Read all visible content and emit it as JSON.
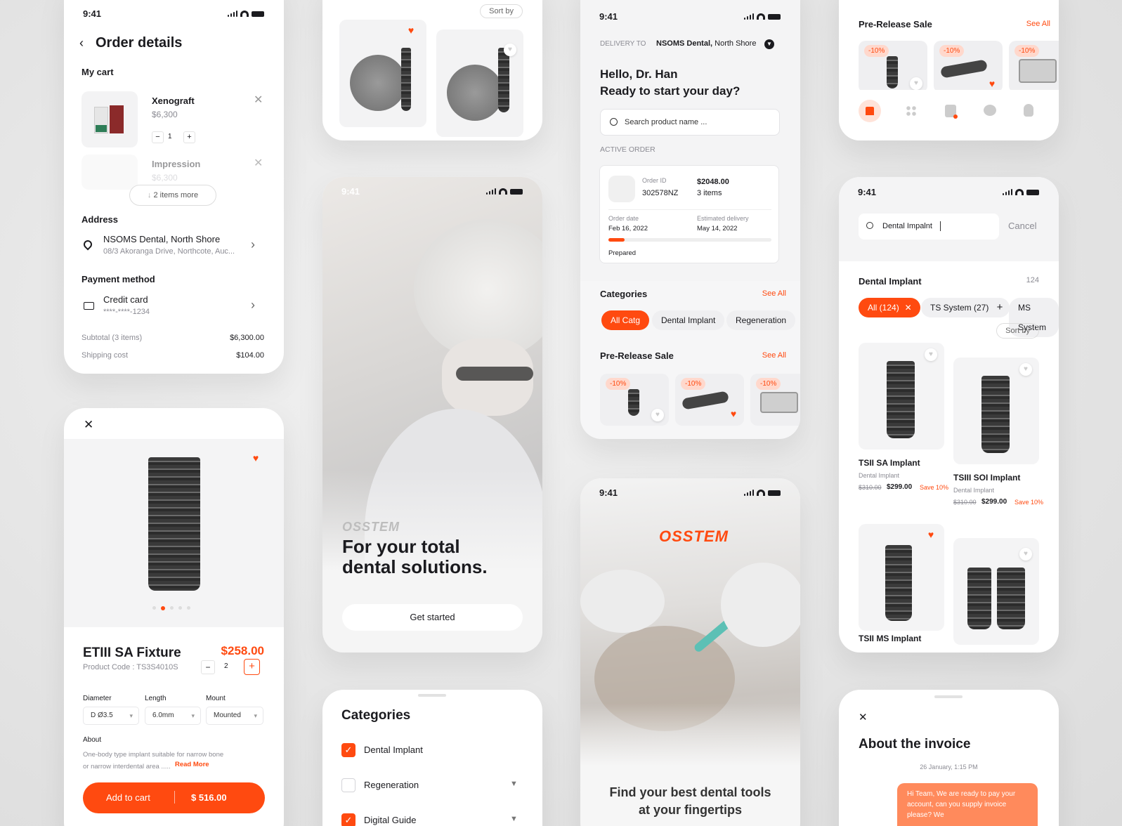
{
  "status_time": "9:41",
  "order": {
    "title": "Order details",
    "my_cart": "My cart",
    "items": [
      {
        "name": "Xenograft",
        "price": "$6,300",
        "qty": "1"
      },
      {
        "name": "Impression",
        "price": "$6,300"
      }
    ],
    "more": "2 items more",
    "address_label": "Address",
    "address_name": "NSOMS Dental, North Shore",
    "address_line": "08/3 Akoranga Drive, Northcote, Auc...",
    "payment_label": "Payment method",
    "payment_name": "Credit card",
    "payment_num": "****-****-1234",
    "subtotal_label": "Subtotal (3 items)",
    "subtotal_value": "$6,300.00",
    "shipping_label": "Shipping cost",
    "shipping_value": "$104.00"
  },
  "product": {
    "name": "ETIII SA Fixture",
    "code": "Product Code : TS3S4010S",
    "price": "$258.00",
    "qty": "2",
    "diameter_label": "Diameter",
    "diameter": "D Ø3.5",
    "length_label": "Length",
    "length": "6.0mm",
    "mount_label": "Mount",
    "mount": "Mounted",
    "about_label": "About",
    "about_text": "One-body type implant suitable for narrow bone or narrow interdental area .....",
    "read_more": "Read More",
    "add_to_cart": "Add to cart",
    "total": "$ 516.00"
  },
  "grid_top": {
    "sort_by": "Sort by"
  },
  "splash": {
    "brand": "OSSTEM",
    "headline": "For your total dental solutions.",
    "cta": "Get started"
  },
  "categories_sheet": {
    "title": "Categories",
    "items": [
      {
        "label": "Dental Implant",
        "checked": true
      },
      {
        "label": "Regeneration",
        "checked": false
      },
      {
        "label": "Digital Guide",
        "checked": true
      }
    ]
  },
  "home": {
    "delivery_to": "DELIVERY TO",
    "delivery_name": "NSOMS Dental,",
    "delivery_area": "North Shore",
    "greeting": "Hello, Dr. Han",
    "subgreeting": "Ready to start your day?",
    "search_placeholder": "Search product name ...",
    "active_order": "ACTIVE ORDER",
    "order_id_label": "Order ID",
    "order_id": "302578NZ",
    "order_total": "$2048.00",
    "order_items": "3 items",
    "order_date_label": "Order date",
    "order_date": "Feb 16, 2022",
    "est_label": "Estimated delivery",
    "est_date": "May 14, 2022",
    "order_status": "Prepared",
    "order_progress": 0.1,
    "categories": "Categories",
    "see_all": "See All",
    "chips": [
      "All Catg",
      "Dental Implant",
      "Regeneration"
    ],
    "pre_release": "Pre-Release Sale",
    "discount": "-10%"
  },
  "onboard": {
    "brand": "OSSTEM",
    "tagline_1": "Find your best dental tools",
    "tagline_2": "at your fingertips"
  },
  "top_right": {
    "pre_release": "Pre-Release Sale",
    "see_all": "See All",
    "discount": "-10%"
  },
  "search": {
    "query": "Dental Impalnt",
    "cancel": "Cancel",
    "heading": "Dental Implant",
    "count": "124",
    "filters": [
      "All (124)",
      "TS System (27)",
      "MS System"
    ],
    "sort_by": "Sort by",
    "products": [
      {
        "name": "TSII SA Implant",
        "cat": "Dental Implant",
        "old": "$310.00",
        "price": "$299.00",
        "save": "Save 10%"
      },
      {
        "name": "TSIII SOI Implant",
        "cat": "Dental Implant",
        "old": "$310.00",
        "price": "$299.00",
        "save": "Save 10%"
      },
      {
        "name": "TSII MS Implant"
      }
    ]
  },
  "invoice": {
    "title": "About the invoice",
    "timestamp": "26 January, 1:15 PM",
    "message": "Hi Team, We are ready to pay your account, can you supply invoice please? We"
  },
  "colors": {
    "accent": "#ff4a10"
  }
}
